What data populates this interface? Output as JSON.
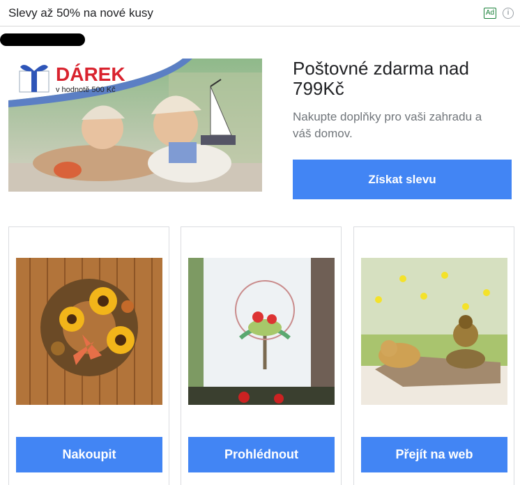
{
  "header": {
    "headline": "Slevy až 50% na nové kusy",
    "ad_badge": "Ad",
    "info_icon": "i"
  },
  "hero": {
    "banner_brand": "DÁREK",
    "banner_sub": "v hodnotě 500 Kč",
    "title": "Poštovné zdarma nad 799Kč",
    "description": "Nakupte doplňky pro vaši zahradu a váš domov.",
    "cta": "Získat slevu"
  },
  "cards": [
    {
      "cta": "Nakoupit",
      "image": "sunflower-wreath"
    },
    {
      "cta": "Prohlédnout",
      "image": "window-sticker-tree"
    },
    {
      "cta": "Přejít na web",
      "image": "buddha-tiger-garden"
    }
  ],
  "colors": {
    "accent": "#4285f4",
    "ad_green": "#188038",
    "brand_red": "#d9232e"
  }
}
